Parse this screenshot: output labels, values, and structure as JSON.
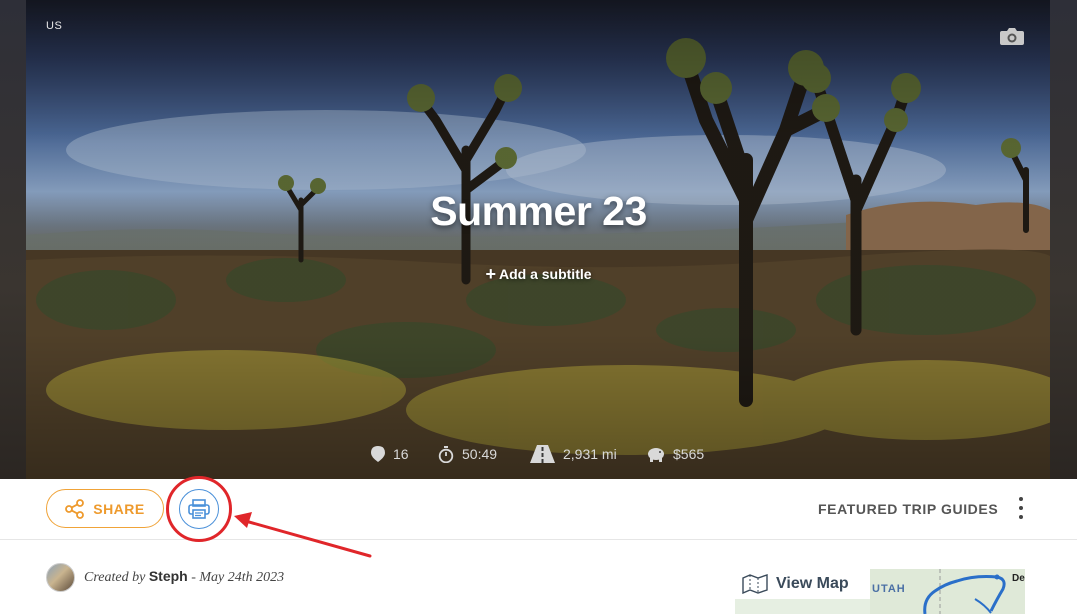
{
  "hero": {
    "country": "US",
    "title": "Summer 23",
    "add_subtitle": "Add a subtitle",
    "stats": {
      "places": "16",
      "duration": "50:49",
      "distance": "2,931 mi",
      "budget": "$565"
    }
  },
  "toolbar": {
    "share_label": "SHARE",
    "featured_label": "FEATURED TRIP GUIDES"
  },
  "created": {
    "prefix": "Created by",
    "author": "Steph",
    "date": "- May 24th 2023"
  },
  "map": {
    "view_label": "View Map",
    "state_label": "UTAH",
    "edge_label": "De"
  },
  "colors": {
    "accent_orange": "#ee9a2d",
    "print_blue": "#4a90d9",
    "annotation_red": "#e0262a"
  },
  "icons": [
    "camera-icon",
    "pin-icon",
    "timer-icon",
    "road-icon",
    "piggy-bank-icon",
    "share-icon",
    "printer-icon",
    "kebab-icon",
    "map-icon"
  ]
}
